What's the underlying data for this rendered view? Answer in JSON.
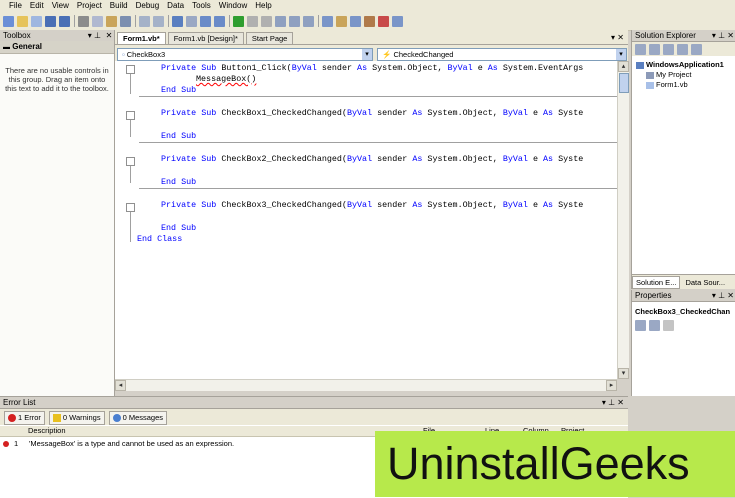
{
  "menu": [
    "File",
    "Edit",
    "View",
    "Project",
    "Build",
    "Debug",
    "Data",
    "Tools",
    "Window",
    "Help"
  ],
  "colors": {
    "keyword": "#0000ff",
    "chrome": "#d4d0c8",
    "watermark_bg": "#b7e94b"
  },
  "toolbox": {
    "title": "Toolbox",
    "pin": "▾ ⊥",
    "close": "✕",
    "group": "General",
    "message": "There are no usable controls in this group. Drag an item onto this text to add it to the toolbox."
  },
  "editor": {
    "tabs": [
      "Form1.vb*",
      "Form1.vb [Design]*",
      "Start Page"
    ],
    "tab_controls": "▾ ✕",
    "class_combo": "CheckBox3",
    "method_combo": "CheckedChanged",
    "code": {
      "l1_kw": "Private Sub",
      "l1_rest": " Button1_Click(",
      "l1_kw2": "ByVal",
      "l1_rest2": " sender ",
      "l1_kw3": "As",
      "l1_rest3": " System.Object, ",
      "l1_kw4": "ByVal",
      "l1_rest4": " e ",
      "l1_kw5": "As",
      "l1_rest5": " System.EventArgs",
      "l2": "MessageBox()",
      "end_sub": "End Sub",
      "cb1_name": " CheckBox1_CheckedChanged(",
      "cb2_name": " CheckBox2_CheckedChanged(",
      "cb3_name": " CheckBox3_CheckedChanged(",
      "sig_tail": " System.Object, ",
      "sig_tail2": " e ",
      "sig_end": " Syste",
      "end_class": "End Class"
    }
  },
  "solution_explorer": {
    "title": "Solution Explorer",
    "controls": "▾ ⊥ ✕",
    "items": [
      "WindowsApplication1",
      "My Project",
      "Form1.vb"
    ],
    "tabs": [
      "Solution E...",
      "Data Sour..."
    ]
  },
  "properties": {
    "title": "Properties",
    "controls": "▾ ⊥ ✕",
    "selected": "CheckBox3_CheckedChan"
  },
  "error_list": {
    "title": "Error List",
    "controls": "▾ ⊥ ✕",
    "tabs": [
      "1 Error",
      "0 Warnings",
      "0 Messages"
    ],
    "columns": [
      "Description",
      "File",
      "Line",
      "Column",
      "Project"
    ],
    "rows": [
      {
        "num": "1",
        "description": "'MessageBox' is a type and cannot be used as an expression."
      }
    ]
  },
  "watermark": "UninstallGeeks"
}
